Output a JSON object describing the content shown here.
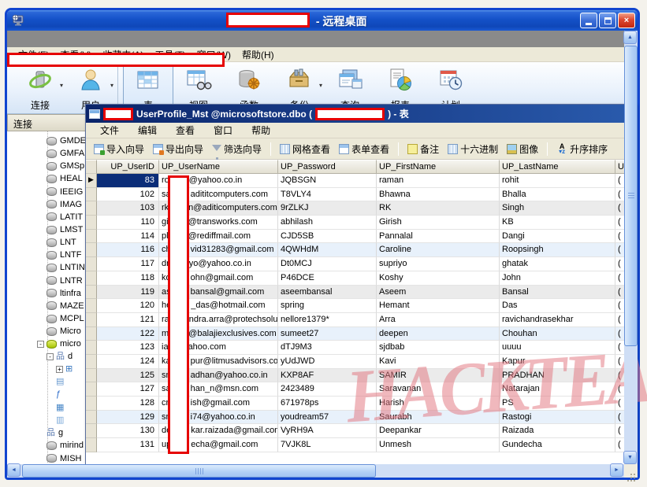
{
  "window": {
    "title_suffix": " - 远程桌面",
    "controls": {
      "minimize": "minimize",
      "maximize": "maximize",
      "close": "close"
    }
  },
  "outer_menu": [
    "文件(F)",
    "查看(V)",
    "收藏夹(A)",
    "工具(T)",
    "窗口(W)",
    "帮助(H)"
  ],
  "outer_toolbar": [
    {
      "label": "连接",
      "icon": "connection-icon",
      "dropdown": true
    },
    {
      "label": "用户",
      "icon": "user-icon",
      "dropdown": true,
      "sep_after": true
    },
    {
      "label": "表",
      "icon": "table-icon",
      "selected": true
    },
    {
      "label": "视图",
      "icon": "view-icon"
    },
    {
      "label": "函数",
      "icon": "function-icon"
    },
    {
      "label": "备份",
      "icon": "backup-icon",
      "dropdown": true
    },
    {
      "label": "查询",
      "icon": "query-icon"
    },
    {
      "label": "报表",
      "icon": "report-icon"
    },
    {
      "label": "计划",
      "icon": "schedule-icon"
    }
  ],
  "sidebar": {
    "header": "连接",
    "items": [
      {
        "label": "GMDE",
        "icon": "database-icon"
      },
      {
        "label": "GMFA",
        "icon": "database-icon"
      },
      {
        "label": "GMSp",
        "icon": "database-icon"
      },
      {
        "label": "HEAL",
        "icon": "database-icon"
      },
      {
        "label": "IEEIG",
        "icon": "database-icon"
      },
      {
        "label": "IMAG",
        "icon": "database-icon"
      },
      {
        "label": "LATIT",
        "icon": "database-icon"
      },
      {
        "label": "LMST",
        "icon": "database-icon"
      },
      {
        "label": "LNT",
        "icon": "database-icon"
      },
      {
        "label": "LNTF",
        "icon": "database-icon"
      },
      {
        "label": "LNTIN",
        "icon": "database-icon"
      },
      {
        "label": "LNTR",
        "icon": "database-icon"
      },
      {
        "label": "ltinfra",
        "icon": "database-icon"
      },
      {
        "label": "MAZE",
        "icon": "database-icon"
      },
      {
        "label": "MCPL",
        "icon": "database-icon"
      },
      {
        "label": "Micro",
        "icon": "database-icon"
      },
      {
        "label": "micro",
        "icon": "database-open-icon",
        "expander": "-"
      },
      {
        "label": "d",
        "icon": "schema-icon",
        "expander": "-",
        "indent": 2
      },
      {
        "label": "",
        "icon": "tables-icon",
        "expander": "+",
        "indent": 3
      },
      {
        "label": "",
        "icon": "views-icon",
        "indent": 3
      },
      {
        "label": "",
        "icon": "functions-icon",
        "indent": 3
      },
      {
        "label": "",
        "icon": "queries-icon",
        "indent": 3
      },
      {
        "label": "",
        "icon": "backups-icon",
        "indent": 3
      },
      {
        "label": "g",
        "icon": "schema-icon",
        "indent": 2
      },
      {
        "label": "mirind",
        "icon": "database-icon"
      },
      {
        "label": "MISH",
        "icon": "database-icon"
      }
    ]
  },
  "inner_window": {
    "title_part1": "UserProfile_Mst @microsoftstore.dbo (",
    "title_part2": ") - 表",
    "menu": [
      "文件",
      "编辑",
      "查看",
      "窗口",
      "帮助"
    ],
    "toolbar": [
      {
        "label": "导入向导",
        "icon": "import-wizard-icon"
      },
      {
        "label": "导出向导",
        "icon": "export-wizard-icon"
      },
      {
        "label": "筛选向导",
        "icon": "filter-wizard-icon",
        "sep_after": true
      },
      {
        "label": "网格查看",
        "icon": "grid-view-icon"
      },
      {
        "label": "表单查看",
        "icon": "form-view-icon",
        "sep_after": true
      },
      {
        "label": "备注",
        "icon": "memo-icon"
      },
      {
        "label": "十六进制",
        "icon": "hex-icon"
      },
      {
        "label": "图像",
        "icon": "image-icon",
        "sep_after": true
      },
      {
        "label": "升序排序",
        "icon": "sort-asc-icon"
      }
    ]
  },
  "table": {
    "columns": [
      "UP_UserID",
      "UP_UserName",
      "UP_Password",
      "UP_FirstName",
      "UP_LastName",
      "U"
    ],
    "rows": [
      {
        "id": "83",
        "user_prefix": "ro",
        "user_suffix": "@yahoo.co.in",
        "password": "JQBSGN",
        "first_name": "raman",
        "last_name": "rohit",
        "phone_fragment": "(",
        "selected": true
      },
      {
        "id": "102",
        "user_prefix": "sa",
        "user_suffix": "adititcomputers.com",
        "password": "T8VLY4",
        "first_name": "Bhawna",
        "last_name": "Bhalla",
        "phone_fragment": "("
      },
      {
        "id": "103",
        "user_prefix": "rk",
        "user_suffix": "n@aditicomputers.com",
        "password": "9rZLKJ",
        "first_name": "RK",
        "last_name": "Singh",
        "phone_fragment": "(",
        "shade": "gray"
      },
      {
        "id": "110",
        "user_prefix": "gi",
        "user_suffix": "@transworks.com",
        "password": "abhilash",
        "first_name": "Girish",
        "last_name": "KB",
        "phone_fragment": "("
      },
      {
        "id": "114",
        "user_prefix": "pl",
        "user_suffix": "@rediffmail.com",
        "password": "CJD5SB",
        "first_name": "Pannalal",
        "last_name": "Dangi",
        "phone_fragment": "("
      },
      {
        "id": "116",
        "user_prefix": "ch",
        "user_suffix": "vid31283@gmail.com",
        "password": "4QWHdM",
        "first_name": "Caroline",
        "last_name": "Roopsingh",
        "phone_fragment": "(",
        "shade": "blue"
      },
      {
        "id": "117",
        "user_prefix": "dr",
        "user_suffix": "yo@yahoo.co.in",
        "password": "Dt0MCJ",
        "first_name": "supriyo",
        "last_name": "ghatak",
        "phone_fragment": "("
      },
      {
        "id": "118",
        "user_prefix": "ko",
        "user_suffix": "ohn@gmail.com",
        "password": "P46DCE",
        "first_name": "Koshy",
        "last_name": "John",
        "phone_fragment": "("
      },
      {
        "id": "119",
        "user_prefix": "as",
        "user_suffix": "bansal@gmail.com",
        "password": "aseembansal",
        "first_name": "Aseem",
        "last_name": "Bansal",
        "phone_fragment": "(",
        "shade": "gray"
      },
      {
        "id": "120",
        "user_prefix": "he",
        "user_suffix": "_das@hotmail.com",
        "password": "spring",
        "first_name": "Hemant",
        "last_name": "Das",
        "phone_fragment": "("
      },
      {
        "id": "121",
        "user_prefix": "ra",
        "user_suffix": "ndra.arra@protechsolu",
        "password": "nellore1379*",
        "first_name": "Arra",
        "last_name": "ravichandrasekhar",
        "phone_fragment": "("
      },
      {
        "id": "122",
        "user_prefix": "m",
        "user_suffix": "@balajiexclusives.com",
        "password": "sumeet27",
        "first_name": "deepen",
        "last_name": "Chouhan",
        "phone_fragment": "(",
        "shade": "blue"
      },
      {
        "id": "123",
        "user_prefix": "ia",
        "user_suffix": "ahoo.com",
        "password": "dTJ9M3",
        "first_name": "sjdbab",
        "last_name": "uuuu",
        "phone_fragment": "("
      },
      {
        "id": "124",
        "user_prefix": "ka",
        "user_suffix": "pur@litmusadvisors.con",
        "password": "yUdJWD",
        "first_name": "Kavi",
        "last_name": "Kapur",
        "phone_fragment": "("
      },
      {
        "id": "125",
        "user_prefix": "sn",
        "user_suffix": "adhan@yahoo.co.in",
        "password": "KXP8AF",
        "first_name": "SAMIR",
        "last_name": "PRADHAN",
        "phone_fragment": "(",
        "shade": "gray"
      },
      {
        "id": "127",
        "user_prefix": "sa",
        "user_suffix": "han_n@msn.com",
        "password": "2423489",
        "first_name": "Saravanan",
        "last_name": "Natarajan",
        "phone_fragment": "("
      },
      {
        "id": "128",
        "user_prefix": "cn",
        "user_suffix": "ish@gmail.com",
        "password": "671978ps",
        "first_name": "Harish",
        "last_name": "PS",
        "phone_fragment": "("
      },
      {
        "id": "129",
        "user_prefix": "sn",
        "user_suffix": "i74@yahoo.co.in",
        "password": "youdream57",
        "first_name": "Saurabh",
        "last_name": "Rastogi",
        "phone_fragment": "(",
        "shade": "blue"
      },
      {
        "id": "130",
        "user_prefix": "de",
        "user_suffix": "kar.raizada@gmail.com",
        "password": "VyRH9A",
        "first_name": "Deepankar",
        "last_name": "Raizada",
        "phone_fragment": "("
      },
      {
        "id": "131",
        "user_prefix": "up",
        "user_suffix": "echa@gmail.com",
        "password": "7VJK8L",
        "first_name": "Unmesh",
        "last_name": "Gundecha",
        "phone_fragment": "("
      }
    ]
  },
  "watermark": {
    "text": "HACKTEACH",
    "color": "#e27680"
  },
  "colors": {
    "redaction_border": "#e60000",
    "selected_cell": "#0b2d78",
    "titlebar_blue": "#1451c8",
    "inner_title_navy": "#0a246a"
  }
}
